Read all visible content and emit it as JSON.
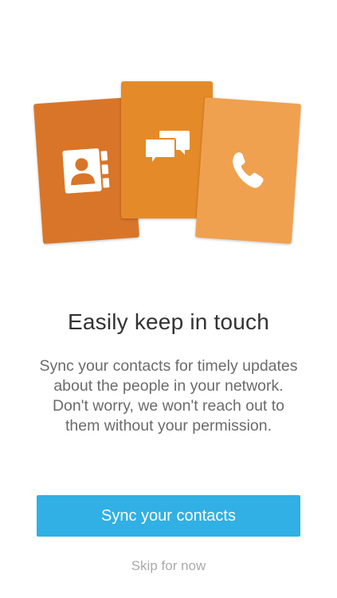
{
  "onboarding": {
    "headline": "Easily keep in touch",
    "body_lines": [
      "Sync your contacts for timely updates",
      "about the people in your network.",
      "Don't worry, we won't reach out to",
      "them without your permission."
    ],
    "primary_button_label": "Sync your contacts",
    "skip_label": "Skip for now"
  },
  "cards": [
    {
      "icon": "address-book-icon",
      "color": "#d97528"
    },
    {
      "icon": "chat-bubbles-icon",
      "color": "#e58a28"
    },
    {
      "icon": "phone-icon",
      "color": "#efa14f"
    }
  ],
  "colors": {
    "primary_button": "#30b0e4",
    "headline": "#333333",
    "body": "#6b6b6b",
    "skip": "#aaaaaa"
  }
}
